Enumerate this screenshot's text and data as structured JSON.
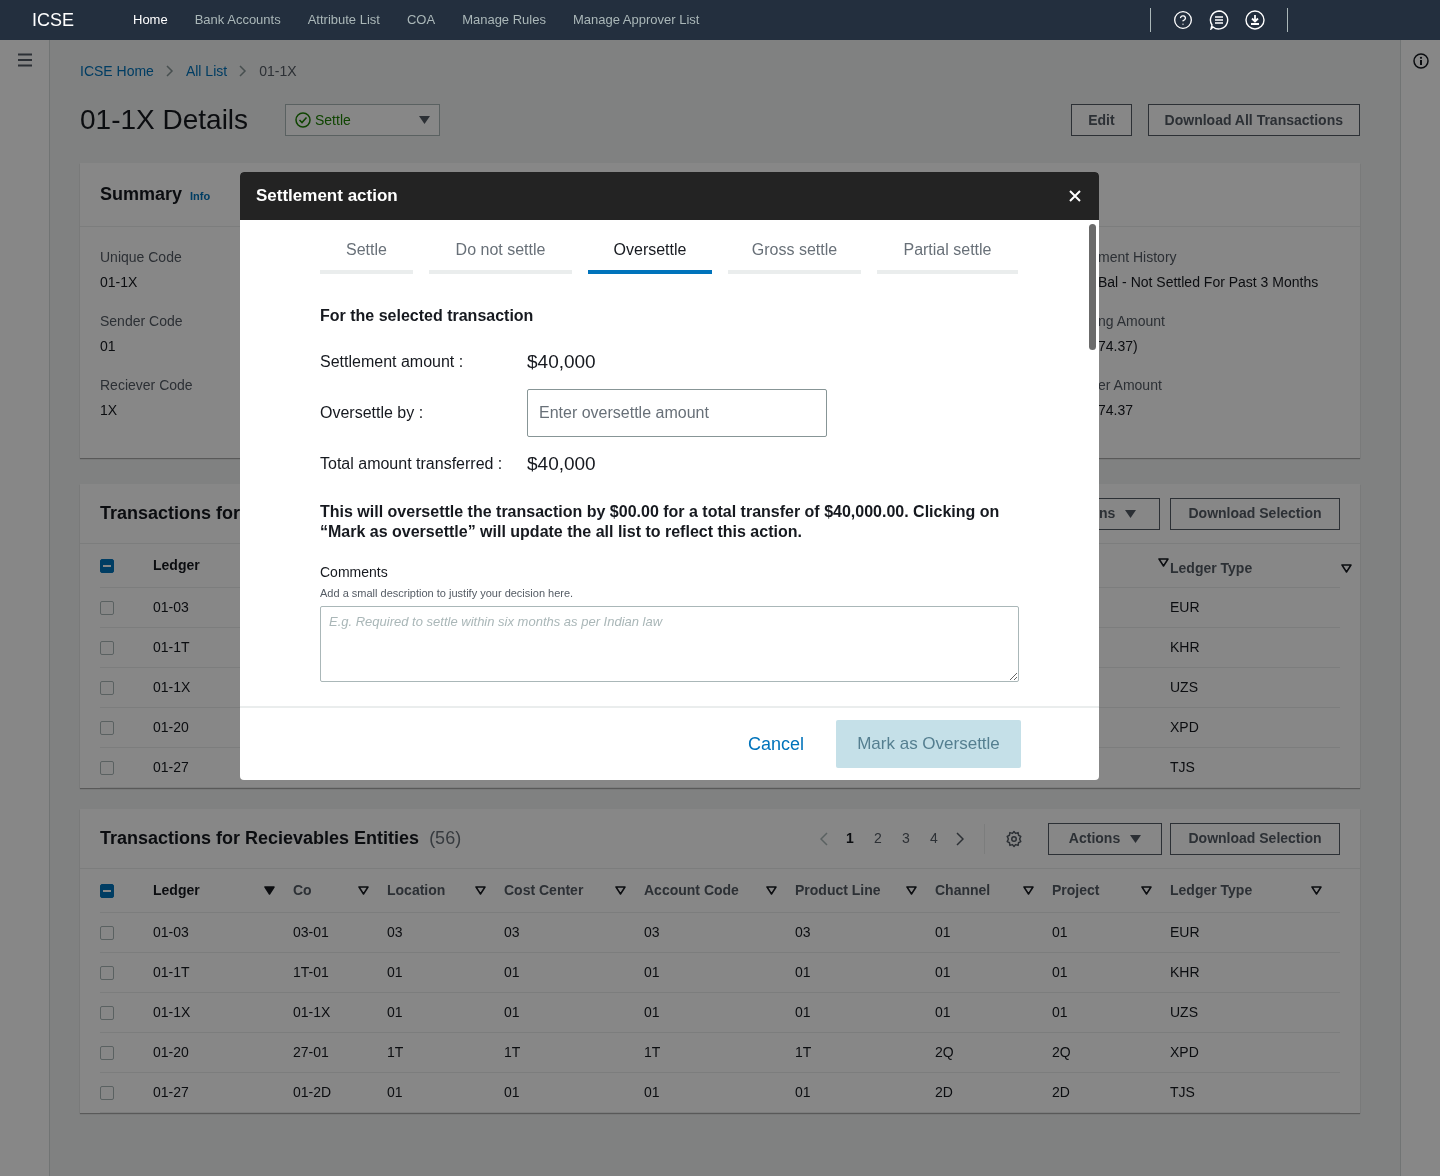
{
  "nav": {
    "brand": "ICSE",
    "items": [
      {
        "label": "Home",
        "selected": true
      },
      {
        "label": "Bank Accounts",
        "selected": false
      },
      {
        "label": "Attribute List",
        "selected": false
      },
      {
        "label": "COA",
        "selected": false
      },
      {
        "label": "Manage Rules",
        "selected": false
      },
      {
        "label": "Manage Approver List",
        "selected": false
      }
    ]
  },
  "breadcrumbs": [
    {
      "label": "ICSE Home",
      "kind": "link"
    },
    {
      "label": "All List",
      "kind": "link"
    },
    {
      "label": "01-1X",
      "kind": "current"
    }
  ],
  "page": {
    "title": "01-1X Details",
    "status_select": {
      "value": "Settle"
    },
    "buttons": [
      "Edit",
      "Download All Transactions"
    ]
  },
  "summary": {
    "title": "Summary",
    "info_link": "Info",
    "fields_left": [
      {
        "label": "Unique Code",
        "value": "01-1X"
      },
      {
        "label": "Sender Code",
        "value": "01"
      },
      {
        "label": "Reciever Code",
        "value": "1X"
      }
    ],
    "fields_right": [
      {
        "label": "ment History",
        "value": "Bal - Not Settled For Past 3 Months"
      },
      {
        "label": "ng Amount",
        "value": "74.37)"
      },
      {
        "label": "er Amount",
        "value": "74.37"
      }
    ]
  },
  "payables_table": {
    "title": "Transactions for",
    "actions_fragment": "ns",
    "download": "Download Selection",
    "header_indeterminate": true,
    "columns": [
      "Ledger",
      "Ledger Type"
    ],
    "rows": [
      {
        "ledger": "01-03",
        "ledger_type": "EUR",
        "checked": false
      },
      {
        "ledger": "01-1T",
        "ledger_type": "KHR",
        "checked": false
      },
      {
        "ledger": "01-1X",
        "ledger_type": "UZS",
        "checked": false
      },
      {
        "ledger": "01-20",
        "ledger_type": "XPD",
        "checked": false
      },
      {
        "ledger": "01-27",
        "ledger_type": "TJS",
        "checked": false
      }
    ]
  },
  "modal": {
    "title": "Settlement action",
    "tabs": [
      {
        "label": "Settle",
        "selected": false
      },
      {
        "label": "Do not settle",
        "selected": false
      },
      {
        "label": "Oversettle",
        "selected": true
      },
      {
        "label": "Gross settle",
        "selected": false
      },
      {
        "label": "Partial settle",
        "selected": false
      }
    ],
    "heading": "For the selected transaction",
    "settlement_label": "Settlement amount :",
    "settlement_value": "$40,000",
    "oversettle_label": "Oversettle by :",
    "oversettle_placeholder": "Enter oversettle amount",
    "total_label": "Total amount transferred :",
    "total_value": "$40,000",
    "message": "This will oversettle the transaction by $00.00 for a total transfer of $40,000.00. Clicking on “Mark as oversettle” will update the all list to reflect this action.",
    "comments_label": "Comments",
    "comments_hint": "Add a small description to justify your decision here.",
    "comments_placeholder": "E.g. Required to settle within six months as per Indian law",
    "cancel": "Cancel",
    "confirm": {
      "label": "Mark as Oversettle",
      "disabled": true
    }
  },
  "receivables_table": {
    "title": "Transactions for Recievables Entities",
    "count": "(56)",
    "pages": [
      {
        "label": "1",
        "selected": true
      },
      {
        "label": "2",
        "selected": false
      },
      {
        "label": "3",
        "selected": false
      },
      {
        "label": "4",
        "selected": false
      }
    ],
    "actions": "Actions",
    "download": "Download Selection",
    "header_indeterminate": true,
    "columns": [
      {
        "label": "Ledger",
        "sorted": true
      },
      {
        "label": "Co",
        "sorted": false
      },
      {
        "label": "Location",
        "sorted": false
      },
      {
        "label": "Cost Center",
        "sorted": false
      },
      {
        "label": "Account Code",
        "sorted": false
      },
      {
        "label": "Product Line",
        "sorted": false
      },
      {
        "label": "Channel",
        "sorted": false
      },
      {
        "label": "Project",
        "sorted": false
      },
      {
        "label": "Ledger Type",
        "sorted": false
      }
    ],
    "rows": [
      {
        "checked": false,
        "cells": [
          "01-03",
          "03-01",
          "03",
          "03",
          "03",
          "03",
          "01",
          "01",
          "EUR"
        ]
      },
      {
        "checked": false,
        "cells": [
          "01-1T",
          "1T-01",
          "01",
          "01",
          "01",
          "01",
          "01",
          "01",
          "KHR"
        ]
      },
      {
        "checked": false,
        "cells": [
          "01-1X",
          "01-1X",
          "01",
          "01",
          "01",
          "01",
          "01",
          "01",
          "UZS"
        ]
      },
      {
        "checked": false,
        "cells": [
          "01-20",
          "27-01",
          "1T",
          "1T",
          "1T",
          "1T",
          "2Q",
          "2Q",
          "XPD"
        ]
      },
      {
        "checked": false,
        "cells": [
          "01-27",
          "01-2D",
          "01",
          "01",
          "01",
          "01",
          "2D",
          "2D",
          "TJS"
        ]
      }
    ]
  }
}
